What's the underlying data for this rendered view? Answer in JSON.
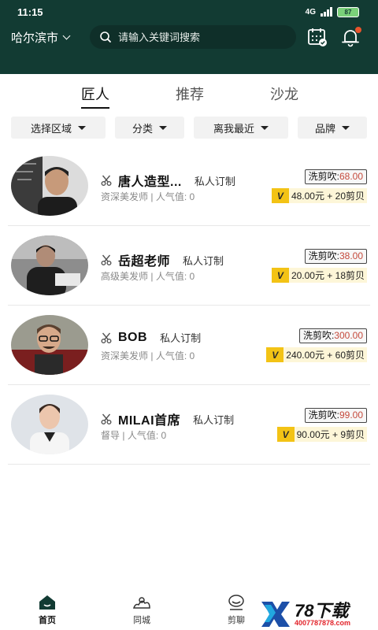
{
  "status_bar": {
    "time": "11:15",
    "network": "4G",
    "battery": "87"
  },
  "header": {
    "city": "哈尔滨市",
    "search_placeholder": "请输入关键词搜索"
  },
  "tabs": [
    {
      "label": "匠人",
      "active": true
    },
    {
      "label": "推荐",
      "active": false
    },
    {
      "label": "沙龙",
      "active": false
    }
  ],
  "filters": [
    {
      "label": "选择区域"
    },
    {
      "label": "分类"
    },
    {
      "label": "离我最近"
    },
    {
      "label": "品牌"
    }
  ],
  "stylists": [
    {
      "name": "唐人造型...",
      "tag": "私人订制",
      "title": "资深美发师",
      "popularity_label": "人气值: 0",
      "price_label": "洗剪吹:",
      "price": "68.00",
      "promo": "48.00元 + 20剪贝",
      "avatar_bg": "#5a5a5a"
    },
    {
      "name": "岳超老师",
      "tag": "私人订制",
      "title": "高级美发师",
      "popularity_label": "人气值: 0",
      "price_label": "洗剪吹:",
      "price": "38.00",
      "promo": "20.00元 + 18剪贝",
      "avatar_bg": "#444444"
    },
    {
      "name": "BOB",
      "tag": "私人订制",
      "title": "资深美发师",
      "popularity_label": "人气值: 0",
      "price_label": "洗剪吹:",
      "price": "300.00",
      "promo": "240.00元 + 60剪贝",
      "avatar_bg": "#7a4a3a"
    },
    {
      "name": "MILAI首席",
      "tag": "私人订制",
      "title": "督导",
      "popularity_label": "人气值: 0",
      "price_label": "洗剪吹:",
      "price": "99.00",
      "promo": "90.00元 + 9剪贝",
      "avatar_bg": "#cfd4da"
    }
  ],
  "bottom_nav": [
    {
      "label": "首页",
      "icon": "home-icon",
      "active": true
    },
    {
      "label": "同城",
      "icon": "map-pin-icon",
      "active": false
    },
    {
      "label": "剪聊",
      "icon": "chat-icon",
      "active": false
    }
  ],
  "watermark": {
    "brand": "78下载",
    "phone": "4007787878.com"
  },
  "colors": {
    "header_bg": "#123b33",
    "price_red": "#c54a3c",
    "promo_yellow": "#f3c315"
  }
}
